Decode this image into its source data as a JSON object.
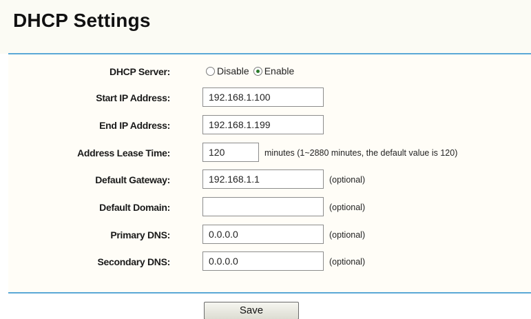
{
  "page": {
    "title": "DHCP Settings"
  },
  "dhcp_server": {
    "label": "DHCP Server:",
    "options": [
      {
        "label": "Disable",
        "checked": false
      },
      {
        "label": "Enable",
        "checked": true
      }
    ]
  },
  "start_ip": {
    "label": "Start IP Address:",
    "value": "192.168.1.100"
  },
  "end_ip": {
    "label": "End IP Address:",
    "value": "192.168.1.199"
  },
  "lease_time": {
    "label": "Address Lease Time:",
    "value": "120",
    "note": "minutes (1~2880 minutes, the default value is 120)"
  },
  "gateway": {
    "label": "Default Gateway:",
    "value": "192.168.1.1",
    "note": "(optional)"
  },
  "domain": {
    "label": "Default Domain:",
    "value": "",
    "note": "(optional)"
  },
  "primary_dns": {
    "label": "Primary DNS:",
    "value": "0.0.0.0",
    "note": "(optional)"
  },
  "secondary_dns": {
    "label": "Secondary DNS:",
    "value": "0.0.0.0",
    "note": "(optional)"
  },
  "actions": {
    "save_label": "Save"
  },
  "colors": {
    "rule": "#5aa8d6",
    "header_background": "#fbfbf4",
    "radio_selected": "#2a7a2a"
  }
}
